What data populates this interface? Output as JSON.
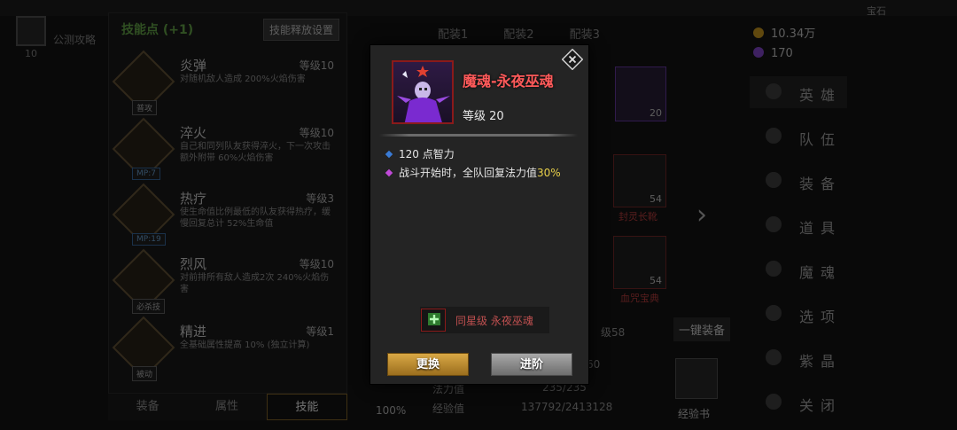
{
  "background": {
    "top_left_text": "公测攻略",
    "top_left_num": "10",
    "skill_panel": {
      "header": "技能点 (+1)",
      "settings_label": "技能释放设置",
      "skills": [
        {
          "name": "炎弹",
          "level": "等级10",
          "tag": "普攻",
          "tag_type": "normal",
          "desc": "对随机敌人造成 200%火焰伤害"
        },
        {
          "name": "淬火",
          "level": "等级10",
          "tag": "MP:7",
          "tag_type": "mp",
          "desc": "自己和同列队友获得淬火，下一次攻击额外附带 60%火焰伤害"
        },
        {
          "name": "热疗",
          "level": "等级3",
          "tag": "MP:19",
          "tag_type": "mp",
          "desc": "使生命值比例最低的队友获得热疗，缓慢回复总计 52%生命值"
        },
        {
          "name": "烈风",
          "level": "等级10",
          "tag": "必杀技",
          "tag_type": "normal",
          "desc": "对前排所有敌人造成2次 240%火焰伤害"
        },
        {
          "name": "精进",
          "level": "等级1",
          "tag": "被动",
          "tag_type": "normal",
          "desc": "全基础属性提高 10% (独立计算)"
        }
      ]
    },
    "bottom_tabs": [
      "装备",
      "属性",
      "技能"
    ],
    "config_tabs": [
      "配装1",
      "配装2",
      "配装3"
    ],
    "equip": [
      {
        "num": "54",
        "label": "封灵长靴"
      },
      {
        "num": "54",
        "label": "血咒宝典"
      }
    ],
    "portrait_level": "20",
    "one_click": "一键装备",
    "exp_book": "经验书",
    "percent": "100%",
    "stats": [
      {
        "label": "级58",
        "value": ""
      },
      {
        "label": "",
        "value": "60"
      },
      {
        "label": "法力值",
        "value": "235/235"
      },
      {
        "label": "经验值",
        "value": "137792/2413128"
      }
    ],
    "currency": [
      {
        "value": "10.34万",
        "color": "#d4a020"
      },
      {
        "value": "170",
        "color": "#8a4ad8"
      }
    ],
    "menu": [
      "英雄",
      "队伍",
      "装备",
      "道具",
      "魔魂",
      "选项",
      "紫晶",
      "关闭"
    ],
    "top_right": "宝石"
  },
  "modal": {
    "name": "魔魂-永夜巫魂",
    "level": "等级 20",
    "attributes": [
      {
        "text": "120 点智力",
        "pct": "",
        "bullet_color": "#3a7bd5"
      },
      {
        "text": "战斗开始时，全队回复法力值",
        "pct": "30%",
        "bullet_color": "#c04ad8"
      }
    ],
    "same_star_label": "同星级 永夜巫魂",
    "replace_label": "更换",
    "advance_label": "进阶"
  }
}
